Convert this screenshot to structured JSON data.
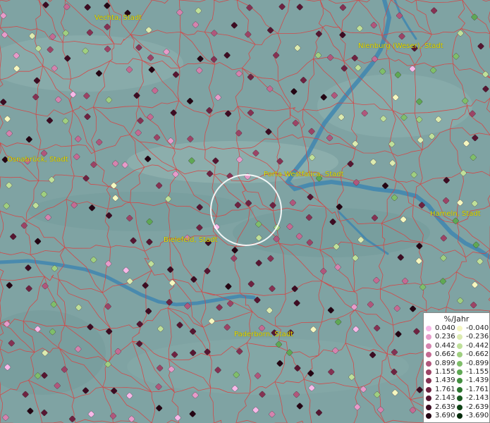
{
  "map": {
    "background_color": "#7fa3a3",
    "border_color": "#d94040",
    "river_color": "#3f86b0",
    "selection_ring_color": "#ffffff"
  },
  "cities": [
    {
      "name": "Vechta, Stadt"
    },
    {
      "name": "Nienburg (Weser), Stadt"
    },
    {
      "name": "Osnabrück, Stadt"
    },
    {
      "name": "Porta Westfalica, Stadt"
    },
    {
      "name": "Hameln, Stadt"
    },
    {
      "name": "Bielefeld, Stadt"
    },
    {
      "name": "Paderborn, Stadt"
    }
  ],
  "legend": {
    "title": "%/Jahr",
    "positive": [
      {
        "label": "0.040",
        "color": "#f7b8e8"
      },
      {
        "label": "0.236",
        "color": "#e69bc9"
      },
      {
        "label": "0.442",
        "color": "#d483ae"
      },
      {
        "label": "0.662",
        "color": "#c46b93"
      },
      {
        "label": "0.899",
        "color": "#b0577c"
      },
      {
        "label": "1.155",
        "color": "#9c4466"
      },
      {
        "label": "1.439",
        "color": "#853253"
      },
      {
        "label": "1.761",
        "color": "#6e2341"
      },
      {
        "label": "2.143",
        "color": "#561631"
      },
      {
        "label": "2.639",
        "color": "#3d0c22"
      },
      {
        "label": "3.690",
        "color": "#240513"
      }
    ],
    "negative": [
      {
        "label": "-0.040",
        "color": "#f5f7c0"
      },
      {
        "label": "-0.236",
        "color": "#dcebb0"
      },
      {
        "label": "-0.442",
        "color": "#bfe09a"
      },
      {
        "label": "-0.662",
        "color": "#9fcf80"
      },
      {
        "label": "-0.899",
        "color": "#7fbe6a"
      },
      {
        "label": "-1.155",
        "color": "#5fa854"
      },
      {
        "label": "-1.439",
        "color": "#438f40"
      },
      {
        "label": "-1.761",
        "color": "#2d7530"
      },
      {
        "label": "-2.143",
        "color": "#1b5c22"
      },
      {
        "label": "-2.639",
        "color": "#0f4416"
      },
      {
        "label": "-3.690",
        "color": "#052b0b"
      }
    ]
  }
}
